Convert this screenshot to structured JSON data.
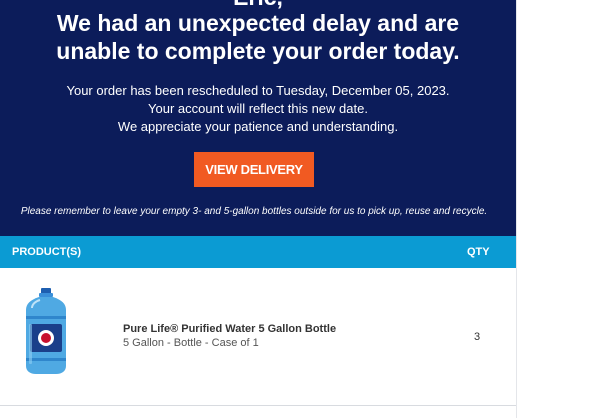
{
  "hero": {
    "greeting": "Eric,",
    "headline_line1": "We had an unexpected delay and are",
    "headline_line2": "unable to complete your order today.",
    "message_line1": "Your order has been rescheduled to Tuesday, December 05, 2023.",
    "message_line2": "Your account will reflect this new date.",
    "message_line3": "We appreciate your patience and understanding.",
    "button_label": "VIEW DELIVERY",
    "note": "Please remember to leave your empty 3- and 5-gallon bottles outside for us to pick up, reuse and recycle."
  },
  "table": {
    "col_product": "PRODUCT(S)",
    "col_qty": "QTY",
    "rows": [
      {
        "name": "Pure Life® Purified Water 5 Gallon Bottle",
        "description": "5 Gallon - Bottle - Case of 1",
        "qty": "3",
        "image_icon": "water-bottle-icon"
      }
    ]
  },
  "colors": {
    "hero_bg": "#0c1c5a",
    "button_bg": "#f15a22",
    "table_header_bg": "#0b9bd3"
  }
}
